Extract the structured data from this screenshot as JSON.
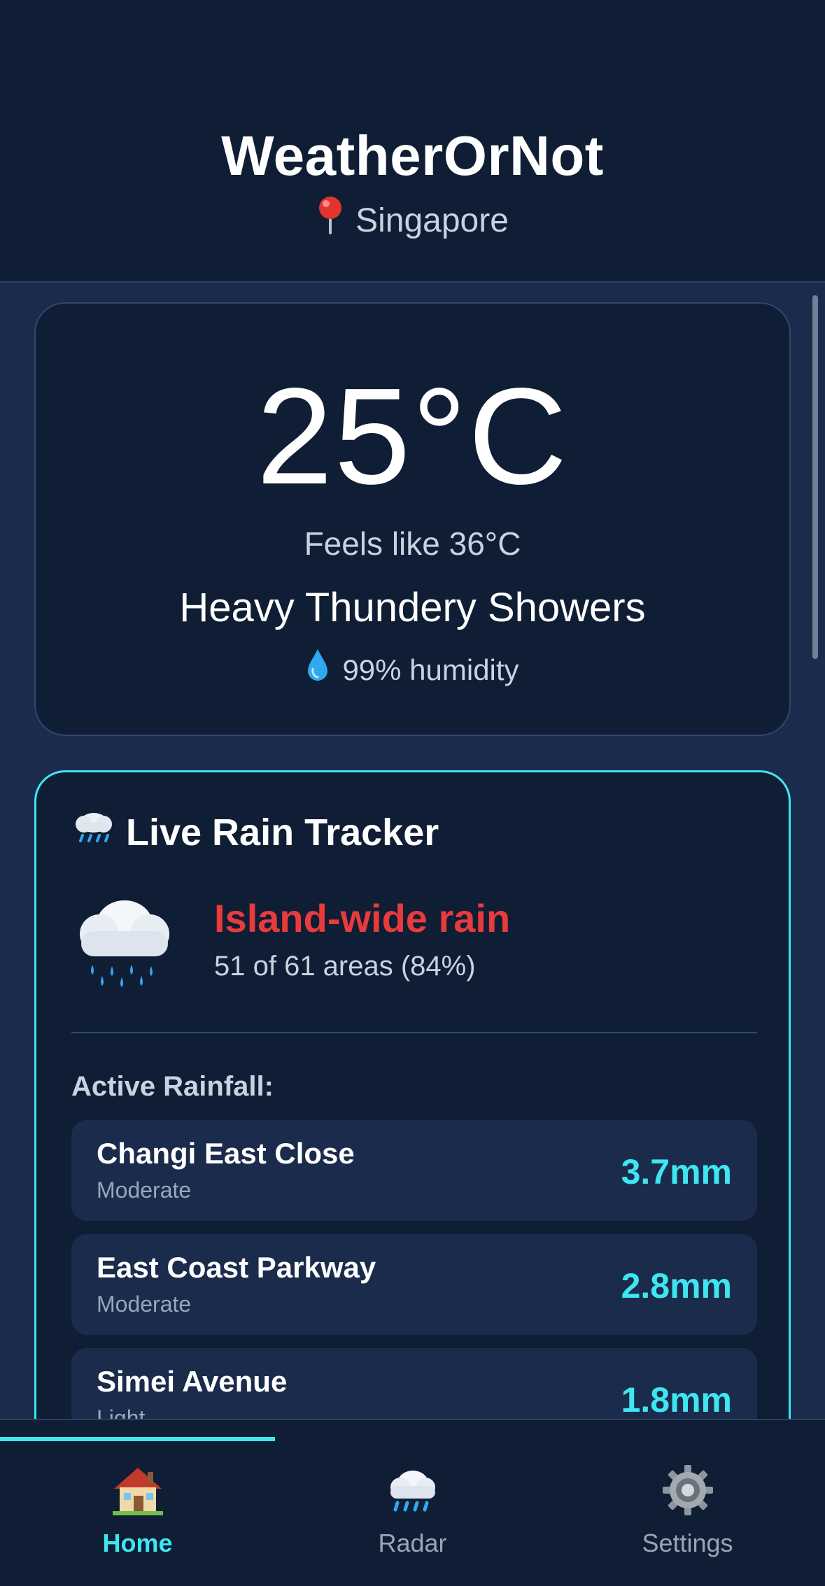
{
  "header": {
    "app_title": "WeatherOrNot",
    "location": "Singapore",
    "location_icon": "pin-icon"
  },
  "current": {
    "temperature": "25°C",
    "feels_like": "Feels like 36°C",
    "condition": "Heavy Thundery Showers",
    "humidity": "99% humidity",
    "humidity_icon": "droplet-icon"
  },
  "rain_tracker": {
    "title": "Live Rain Tracker",
    "title_icon": "rain-cloud-icon",
    "status": "Island-wide rain",
    "status_color": "#e83b3b",
    "summary": "51 of 61 areas (84%)",
    "section_label": "Active Rainfall:",
    "areas": [
      {
        "name": "Changi East Close",
        "level": "Moderate",
        "amount": "3.7mm"
      },
      {
        "name": "East Coast Parkway",
        "level": "Moderate",
        "amount": "2.8mm"
      },
      {
        "name": "Simei Avenue",
        "level": "Light",
        "amount": "1.8mm"
      }
    ]
  },
  "nav": {
    "items": [
      {
        "label": "Home",
        "icon": "house-icon",
        "active": true
      },
      {
        "label": "Radar",
        "icon": "rain-cloud-icon",
        "active": false
      },
      {
        "label": "Settings",
        "icon": "gear-icon",
        "active": false
      }
    ]
  },
  "colors": {
    "background": "#1b2b4b",
    "card": "#0f1e35",
    "accent": "#3ee6f2",
    "alert": "#e83b3b"
  }
}
